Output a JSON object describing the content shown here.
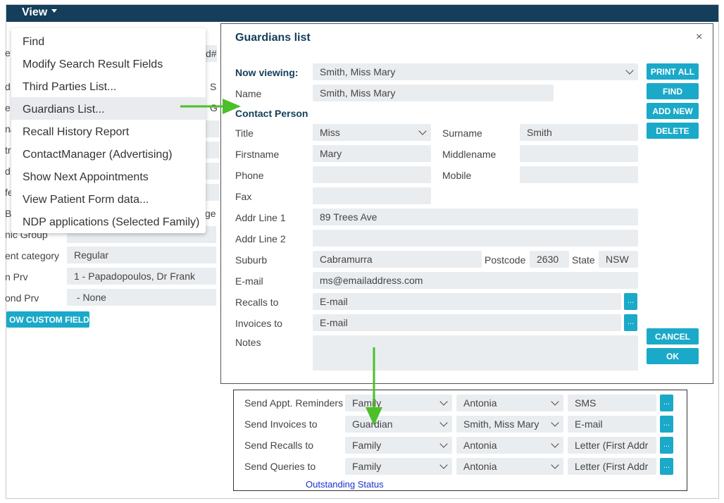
{
  "menu": {
    "view_label": "View"
  },
  "dropdown": {
    "items": [
      "Find",
      "Modify Search Result Fields",
      "Third Parties List...",
      "Guardians List...",
      "Recall History Report",
      "ContactManager (Advertising)",
      "Show Next Appointments",
      "View Patient Form data...",
      "NDP applications (Selected Family)"
    ],
    "active_index": 3
  },
  "background_form": {
    "partial_right_1": "d#",
    "partial_right_2": "S",
    "partial_right_3": "G",
    "partial_right_4": "ge",
    "partial_left": [
      "e",
      "d",
      "e",
      "na",
      "tr",
      "d",
      "fe",
      "B"
    ],
    "ethnic_group_label": "nic Group",
    "patient_category_label": "ent category",
    "patient_category_value": "Regular",
    "main_prv_label": "n Prv",
    "main_prv_value": "1 - Papadopoulos, Dr Frank",
    "second_prv_label": "ond Prv",
    "second_prv_value": " - None",
    "custom_fields_button": "OW CUSTOM FIELDS"
  },
  "modal": {
    "title": "Guardians list",
    "close": "×",
    "now_viewing_label": "Now viewing:",
    "now_viewing_value": "Smith, Miss Mary",
    "name_label": "Name",
    "name_value": "Smith, Miss Mary",
    "contact_person_label": "Contact Person",
    "title_label": "Title",
    "title_value": "Miss",
    "surname_label": "Surname",
    "surname_value": "Smith",
    "firstname_label": "Firstname",
    "firstname_value": "Mary",
    "middlename_label": "Middlename",
    "middlename_value": "",
    "phone_label": "Phone",
    "phone_value": "",
    "mobile_label": "Mobile",
    "mobile_value": "",
    "fax_label": "Fax",
    "fax_value": "",
    "addr1_label": "Addr Line 1",
    "addr1_value": "89 Trees Ave",
    "addr2_label": "Addr Line 2",
    "addr2_value": "",
    "suburb_label": "Suburb",
    "suburb_value": "Cabramurra",
    "postcode_label": "Postcode",
    "postcode_value": "2630",
    "state_label": "State",
    "state_value": "NSW",
    "email_label": "E-mail",
    "email_value": "ms@emailaddress.com",
    "recalls_label": "Recalls to",
    "recalls_value": "E-mail",
    "invoices_label": "Invoices to",
    "invoices_value": "E-mail",
    "notes_label": "Notes",
    "notes_value": "",
    "dots": "...",
    "buttons": {
      "print_all": "PRINT ALL",
      "find": "FIND",
      "add_new": "ADD NEW",
      "delete": "DELETE",
      "cancel": "CANCEL",
      "ok": "OK"
    }
  },
  "comms": {
    "rows": [
      {
        "label": "Send Appt. Reminders",
        "who": "Family",
        "person": "Antonia",
        "method": "SMS"
      },
      {
        "label": "Send Invoices to",
        "who": "Guardian",
        "person": "Smith, Miss Mary",
        "method": "E-mail"
      },
      {
        "label": "Send Recalls to",
        "who": "Family",
        "person": "Antonia",
        "method": "Letter (First Addr"
      },
      {
        "label": "Send Queries to",
        "who": "Family",
        "person": "Antonia",
        "method": "Letter (First Addr"
      }
    ],
    "dots": "...",
    "status_link": "Outstanding Status"
  },
  "colors": {
    "topbar": "#143e5a",
    "accent": "#1ba9c9",
    "arrow": "#4cbf2a",
    "field_bg": "#eaedf0",
    "link": "#1a33c8"
  }
}
